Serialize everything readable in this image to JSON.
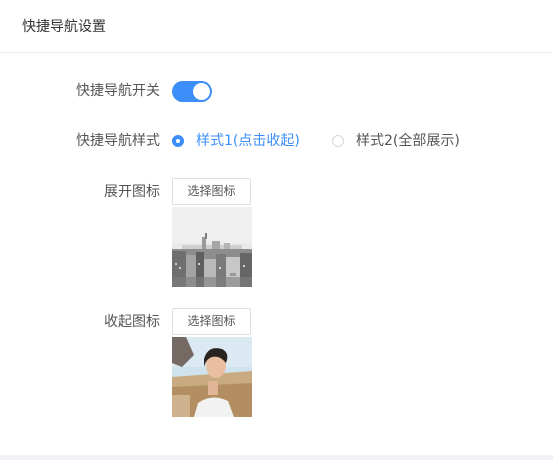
{
  "header": {
    "title": "快捷导航设置"
  },
  "form": {
    "toggle": {
      "label": "快捷导航开关",
      "on": true,
      "color": "#3d8ef8"
    },
    "style": {
      "label": "快捷导航样式",
      "options": [
        {
          "label": "样式1(点击收起)",
          "checked": true
        },
        {
          "label": "样式2(全部展示)",
          "checked": false
        }
      ]
    },
    "expand_icon": {
      "label": "展开图标",
      "button_label": "选择图标"
    },
    "collapse_icon": {
      "label": "收起图标",
      "button_label": "选择图标"
    }
  }
}
